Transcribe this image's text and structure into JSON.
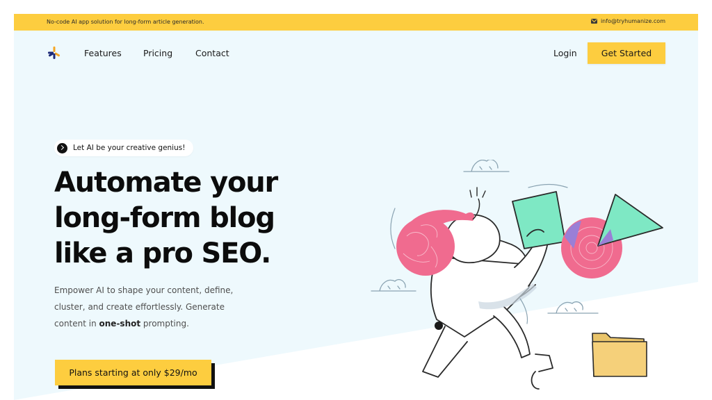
{
  "topbar": {
    "tagline": "No-code AI app solution for long-form article generation.",
    "email_icon": "mail-icon",
    "email": "info@tryhumanize.com"
  },
  "nav": {
    "logo_icon": "asterisk-logo-icon",
    "links": [
      "Features",
      "Pricing",
      "Contact"
    ],
    "login_label": "Login",
    "cta_label": "Get Started"
  },
  "hero": {
    "pill_icon": "chevron-right-circle-icon",
    "pill_text": "Let AI be your creative genius!",
    "headline": [
      "Automate your",
      "long-form blog",
      "like a pro SEO."
    ],
    "subtext_line1": "Empower AI to shape your content, define,",
    "subtext_line2": "cluster, and create effortlessly. Generate",
    "subtext_line3_before": "content in ",
    "subtext_line3_bold": "one-shot",
    "subtext_line3_after": " prompting.",
    "cta_label": "Plans starting at only $29/mo"
  },
  "colors": {
    "accent_yellow": "#fdcd3f",
    "background": "#eef9fd",
    "pink": "#f06b8f",
    "mint": "#7ee8c4",
    "purple": "#9a7fd6",
    "navy": "#1e2a78",
    "orange": "#f5a623"
  }
}
